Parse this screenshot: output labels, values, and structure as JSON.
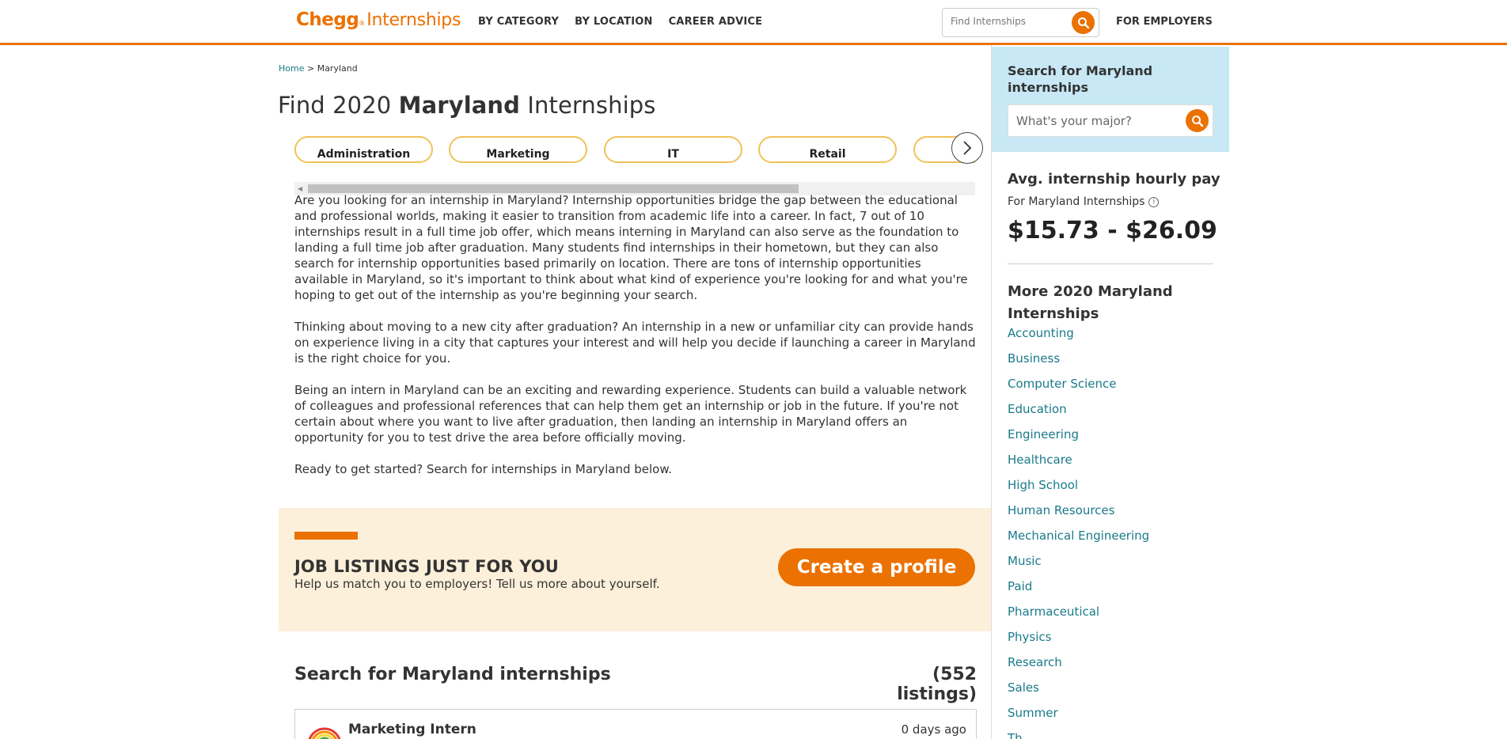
{
  "header": {
    "logo_brand": "Chegg",
    "logo_reg": "®",
    "logo_product": "Internships",
    "nav": [
      "BY CATEGORY",
      "BY LOCATION",
      "CAREER ADVICE"
    ],
    "search_placeholder": "Find Internships",
    "employers_label": "FOR EMPLOYERS"
  },
  "breadcrumb": {
    "home": "Home",
    "separator": ">",
    "current": "Maryland"
  },
  "title": {
    "prefix": "Find 2020",
    "bold": "Maryland",
    "suffix": "Internships"
  },
  "categories": [
    "Administration",
    "Marketing",
    "IT",
    "Retail",
    ""
  ],
  "copy": [
    "Are you looking for an internship in Maryland? Internship opportunities bridge the gap between the educational and professional worlds, making it easier to transition from academic life into a career. In fact, 7 out of 10 internships result in a full time job offer, which means interning in Maryland can also serve as the foundation to landing a full time job after graduation. Many students find internships in their hometown, but they can also search for internship opportunities based primarily on location. There are tons of internship opportunities available in Maryland, so it's important to think about what kind of experience you're looking for and what you're hoping to get out of the internship as you're beginning your search.",
    "Thinking about moving to a new city after graduation? An internship in a new or unfamiliar city can provide hands on experience living in a city that captures your interest and will help you decide if launching a career in Maryland is the right choice for you.",
    "Being an intern in Maryland can be an exciting and rewarding experience. Students can build a valuable network of colleagues and professional references that can help them get an internship or job in the future. If you're not certain about where you want to live after graduation, then landing an internship in Maryland offers an opportunity for you to test drive the area before officially moving.",
    "Ready to get started? Search for internships in Maryland below."
  ],
  "banner": {
    "heading": "JOB LISTINGS JUST FOR YOU",
    "subtext": "Help us match you to employers! Tell us more about yourself.",
    "button": "Create a profile"
  },
  "results": {
    "title": "Search for Maryland internships",
    "count": "(552 listings)",
    "listings": [
      {
        "title": "Marketing Intern",
        "age": "0 days ago"
      }
    ]
  },
  "sidebar": {
    "search_heading": "Search for Maryland internships",
    "search_placeholder": "What's your major?",
    "pay_title": "Avg. internship hourly pay",
    "pay_sub": "For Maryland Internships",
    "pay_value": "$15.73 - $26.09",
    "more_title": "More 2020 Maryland Internships",
    "more_links": [
      "Accounting",
      "Business",
      "Computer Science",
      "Education",
      "Engineering",
      "Healthcare",
      "High School",
      "Human Resources",
      "Mechanical Engineering",
      "Music",
      "Paid",
      "Pharmaceutical",
      "Physics",
      "Research",
      "Sales",
      "Summer",
      "Th..."
    ]
  },
  "colors": {
    "brand_orange": "#eb7100",
    "chip_border": "#f0c25a",
    "link_teal": "#1a7a8a",
    "sidebar_search_bg": "#c8e8f5",
    "banner_bg": "#fdf0da"
  },
  "icons": {
    "search": "search-icon",
    "chevron": "chevron-right-icon",
    "info": "info-icon",
    "company_logo": "rainbow-logo-icon"
  }
}
